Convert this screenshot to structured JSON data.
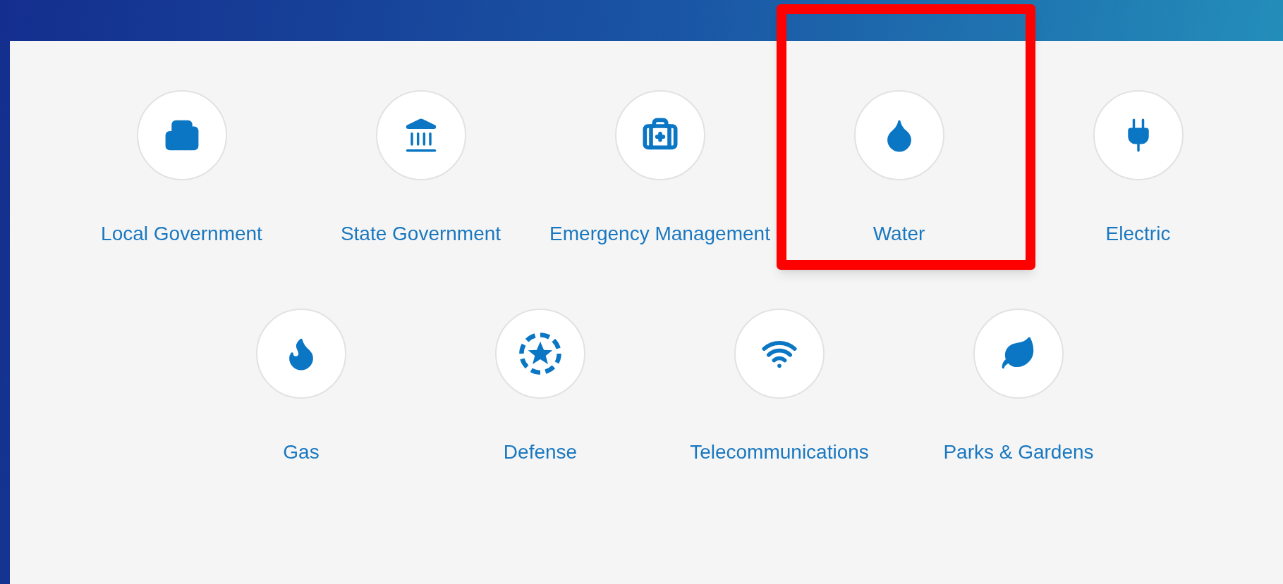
{
  "rows": [
    [
      {
        "label": "Local Government",
        "selected": false
      },
      {
        "label": "State Government",
        "selected": false
      },
      {
        "label": "Emergency Management",
        "selected": false
      },
      {
        "label": "Water",
        "selected": true
      },
      {
        "label": "Electric",
        "selected": false
      }
    ],
    [
      {
        "label": "Gas",
        "selected": false
      },
      {
        "label": "Defense",
        "selected": false
      },
      {
        "label": "Telecommunications",
        "selected": false
      },
      {
        "label": "Parks & Gardens",
        "selected": false
      }
    ]
  ]
}
